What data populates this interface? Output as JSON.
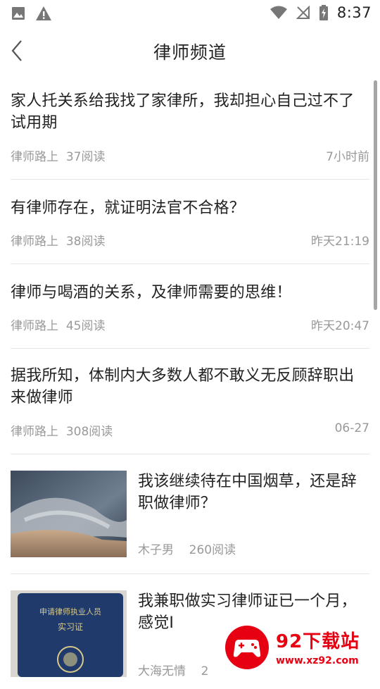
{
  "status_bar": {
    "time": "8:37",
    "left_icons": [
      "image-icon",
      "warning-icon"
    ],
    "right_icons": [
      "wifi-icon",
      "no-signal-icon",
      "battery-charging-icon"
    ]
  },
  "header": {
    "title": "律师频道"
  },
  "feed": [
    {
      "title": "家人托关系给我找了家律所，我却担心自己过不了试用期",
      "author": "律师路上",
      "reads": "37阅读",
      "time": "7小时前"
    },
    {
      "title": "有律师存在，就证明法官不合格？",
      "author": "律师路上",
      "reads": "38阅读",
      "time": "昨天21:19"
    },
    {
      "title": "律师与喝酒的关系，及律师需要的思维！",
      "author": "律师路上",
      "reads": "45阅读",
      "time": "昨天20:47"
    },
    {
      "title": "据我所知，体制内大多数人都不敢义无反顾辞职出来做律师",
      "author": "律师路上",
      "reads": "308阅读",
      "time": "06-27"
    },
    {
      "title": "我该继续待在中国烟草，还是辞职做律师？",
      "author": "木子男",
      "reads": "260阅读",
      "image": "storm-cloud-photo"
    },
    {
      "title": "我兼职做实习律师证已一个月，感觉I",
      "author": "大海无情",
      "reads": "2",
      "image": "lawyer-certificate-photo",
      "cert_text_1": "申请律师执业人员",
      "cert_text_2": "实习证"
    }
  ],
  "watermark": {
    "title": "92下载站",
    "url": "www.xz92.com"
  },
  "colors": {
    "text": "#222222",
    "meta": "#999999",
    "divider": "#e6e6e6",
    "watermark": "#e60012"
  }
}
